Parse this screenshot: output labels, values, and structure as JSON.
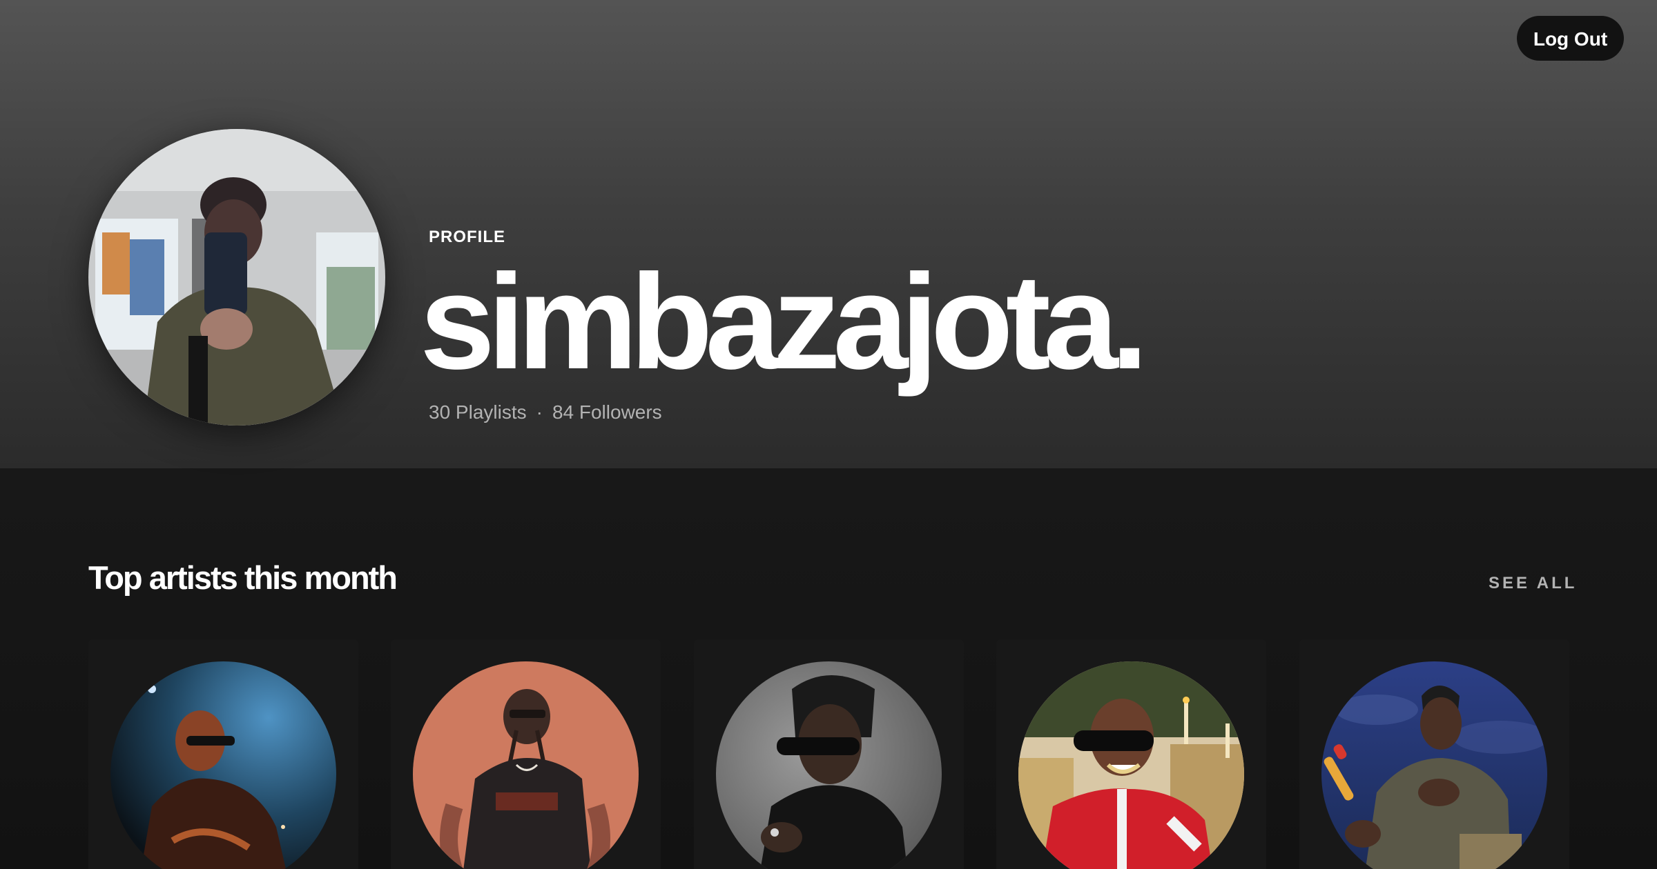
{
  "header": {
    "logout_label": "Log Out",
    "profile_label": "PROFILE",
    "username": "simbazajota.",
    "playlists": "30 Playlists",
    "separator": "·",
    "followers": "84 Followers"
  },
  "top_artists": {
    "title": "Top artists this month",
    "see_all_label": "SEE ALL",
    "artists": [
      {
        "image": "artist-photo-1",
        "accent": "#3a6f9a"
      },
      {
        "image": "artist-photo-2",
        "accent": "#c06a4e"
      },
      {
        "image": "artist-photo-3",
        "accent": "#6e6e6e"
      },
      {
        "image": "artist-photo-4",
        "accent": "#c8282e"
      },
      {
        "image": "artist-photo-5",
        "accent": "#2a3f82"
      }
    ]
  },
  "colors": {
    "background": "#121212",
    "card": "#181818",
    "header_top": "#545454",
    "header_bottom": "#2b2b2b",
    "muted_text": "#b3b3b3"
  }
}
